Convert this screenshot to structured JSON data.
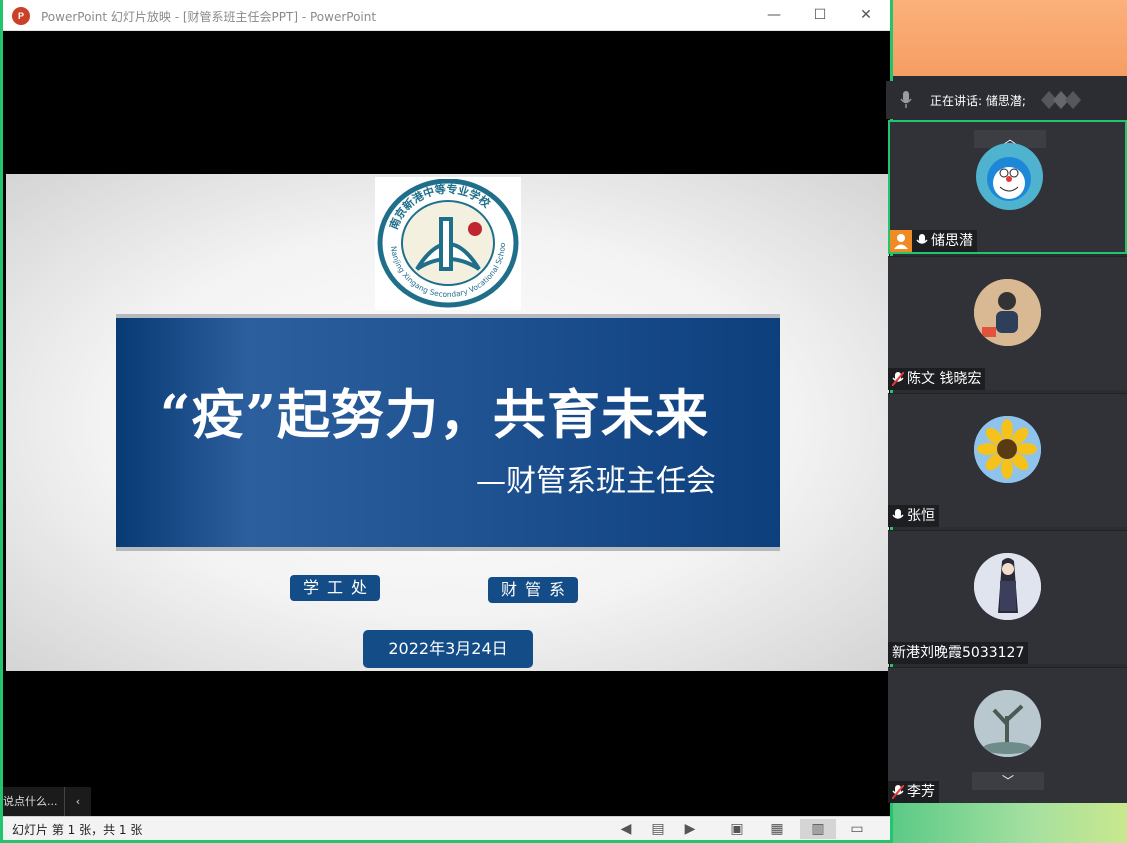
{
  "window": {
    "title": "PowerPoint 幻灯片放映 - [财管系班主任会PPT] - PowerPoint",
    "app_icon_label": "P",
    "minimize": "—",
    "maximize": "☐",
    "close": "✕"
  },
  "slide": {
    "logo_text_top": "南京新港中等专业学校",
    "logo_text_bottom": "Nanjing Xingang Secondary Vocational School",
    "title": "“疫”起努力，共育未来",
    "subtitle": "—财管系班主任会",
    "tag_1": "学工处",
    "tag_2": "财管系",
    "date": "2022年3月24日"
  },
  "left_popup": {
    "text": "说点什么...",
    "chevron": "‹"
  },
  "statusbar": {
    "slide_info": "幻灯片 第 1 张，共 1 张",
    "icons": [
      "prev-icon",
      "notes-icon",
      "next-icon",
      "normal-view-icon",
      "slide-sorter-icon",
      "reading-view-icon",
      "slideshow-icon"
    ]
  },
  "meeting": {
    "speaking_label": "正在讲话: 储思潜;",
    "participants": [
      {
        "name": "储思潜",
        "host": true,
        "active": true
      },
      {
        "name": "陈文 钱晓宏",
        "muted": true
      },
      {
        "name": "张恒",
        "muted": false
      },
      {
        "name": "新港刘晚霞5033127"
      },
      {
        "name": "李芳",
        "muted": true
      }
    ],
    "scroll_up": "︿",
    "scroll_down": "﹀"
  },
  "colors": {
    "window_border": "#22c46c",
    "banner_blue": "#1f5291",
    "tag_blue": "#134c86",
    "host_orange": "#f08a24"
  }
}
